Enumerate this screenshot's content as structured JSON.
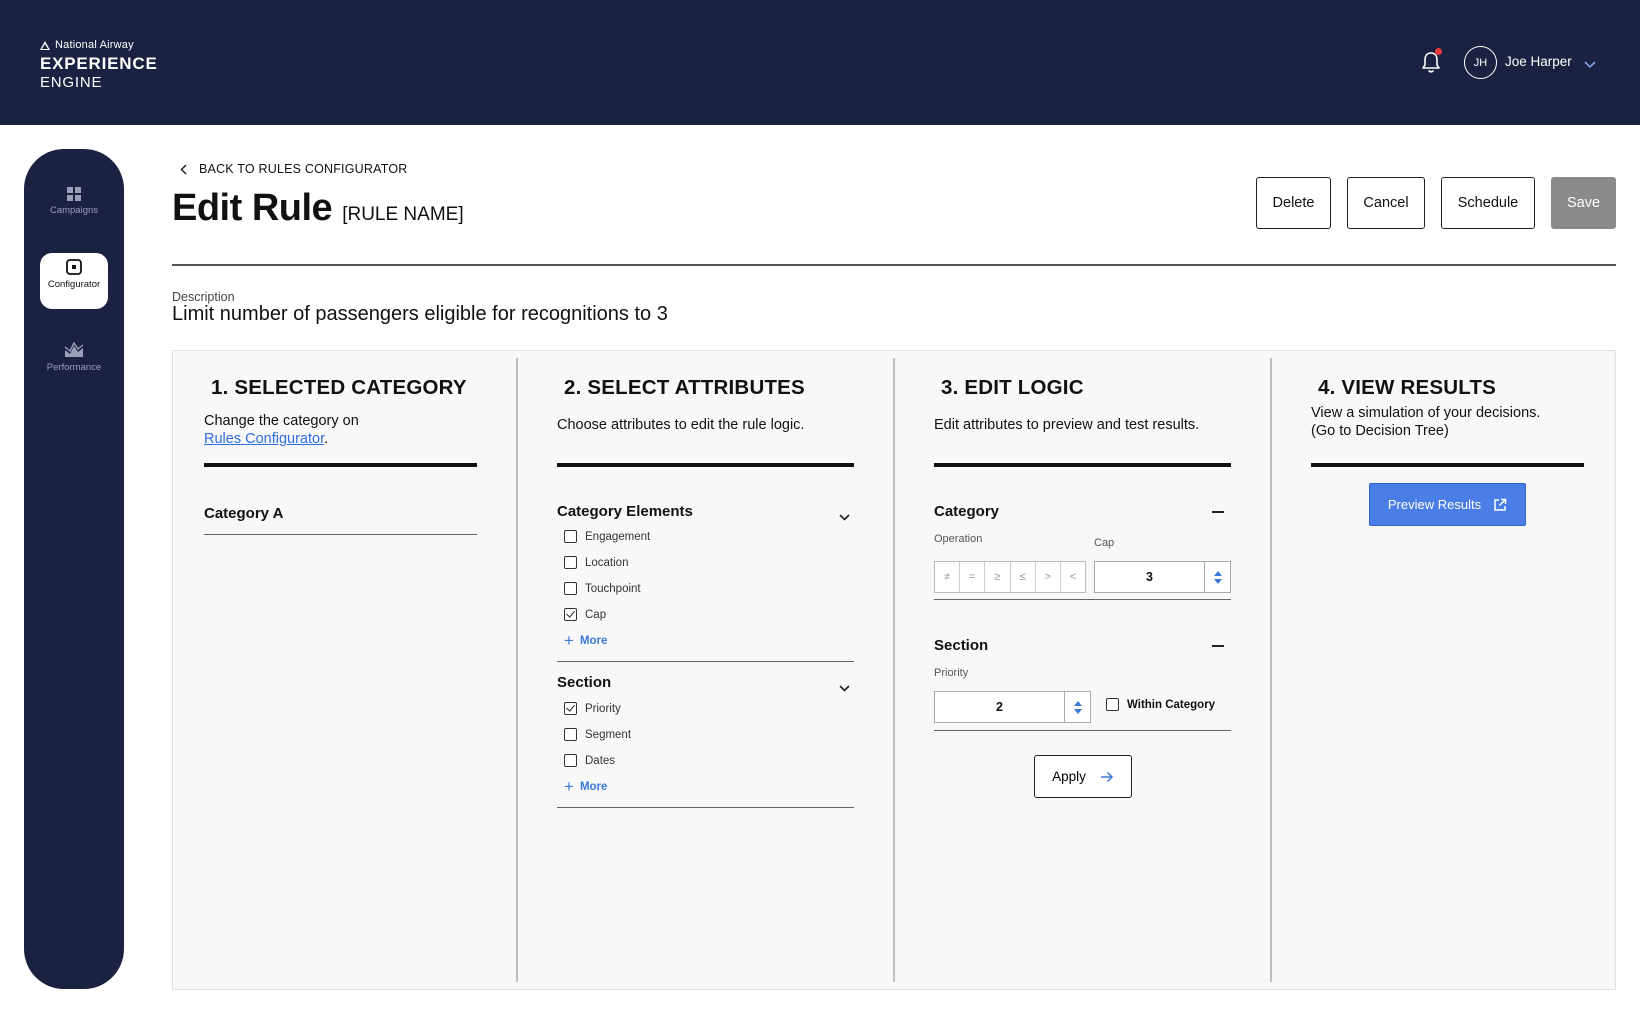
{
  "brand": {
    "line1": "National Airway",
    "line2": "EXPERIENCE",
    "line3": "ENGINE"
  },
  "user": {
    "initials": "JH",
    "name": "Joe Harper"
  },
  "sidebar": {
    "items": [
      {
        "label": "Campaigns",
        "icon": "grid-icon",
        "active": false
      },
      {
        "label": "Configurator",
        "icon": "configurator-icon",
        "active": true
      },
      {
        "label": "Performance",
        "icon": "performance-icon",
        "active": false
      }
    ]
  },
  "header": {
    "back_label": "BACK TO RULES CONFIGURATOR",
    "title": "Edit Rule",
    "rule_name": "[RULE NAME]",
    "buttons": {
      "delete": "Delete",
      "cancel": "Cancel",
      "schedule": "Schedule",
      "save": "Save"
    }
  },
  "description": {
    "label": "Description",
    "text": "Limit number of  passengers eligible for recognitions to 3"
  },
  "col1": {
    "number": "1.",
    "title": "SELECTED CATEGORY",
    "sub_text": "Change the category on",
    "sub_link": "Rules Configurator",
    "sub_link_suffix": ".",
    "category": "Category A"
  },
  "col2": {
    "number": "2.",
    "title": "SELECT ATTRIBUTES",
    "sub": "Choose attributes to edit the rule logic.",
    "groups": [
      {
        "title": "Category Elements",
        "items": [
          {
            "label": "Engagement",
            "checked": false
          },
          {
            "label": "Location",
            "checked": false
          },
          {
            "label": "Touchpoint",
            "checked": false
          },
          {
            "label": "Cap",
            "checked": true
          }
        ],
        "more": "More"
      },
      {
        "title": "Section",
        "items": [
          {
            "label": "Priority",
            "checked": true
          },
          {
            "label": "Segment",
            "checked": false
          },
          {
            "label": "Dates",
            "checked": false
          }
        ],
        "more": "More"
      }
    ]
  },
  "col3": {
    "number": "3.",
    "title": "EDIT LOGIC",
    "sub": "Edit attributes to preview and test results.",
    "category": {
      "title": "Category",
      "operation_label": "Operation",
      "operators": [
        "≠",
        "=",
        "≥",
        "≤",
        ">",
        "<"
      ],
      "cap_label": "Cap",
      "cap_value": "3"
    },
    "section": {
      "title": "Section",
      "priority_label": "Priority",
      "priority_value": "2",
      "within_label": "Within Category",
      "within_checked": false
    },
    "apply": "Apply"
  },
  "col4": {
    "number": "4.",
    "title": "VIEW RESULTS",
    "sub_line1": "View a simulation of your decisions.",
    "sub_line2": "(Go to Decision Tree)",
    "preview": "Preview Results"
  },
  "colors": {
    "navy": "#1b2140",
    "accent_blue": "#4a7ee6",
    "notification_dot": "#e83a3a",
    "save_disabled": "#8a8a8a"
  }
}
